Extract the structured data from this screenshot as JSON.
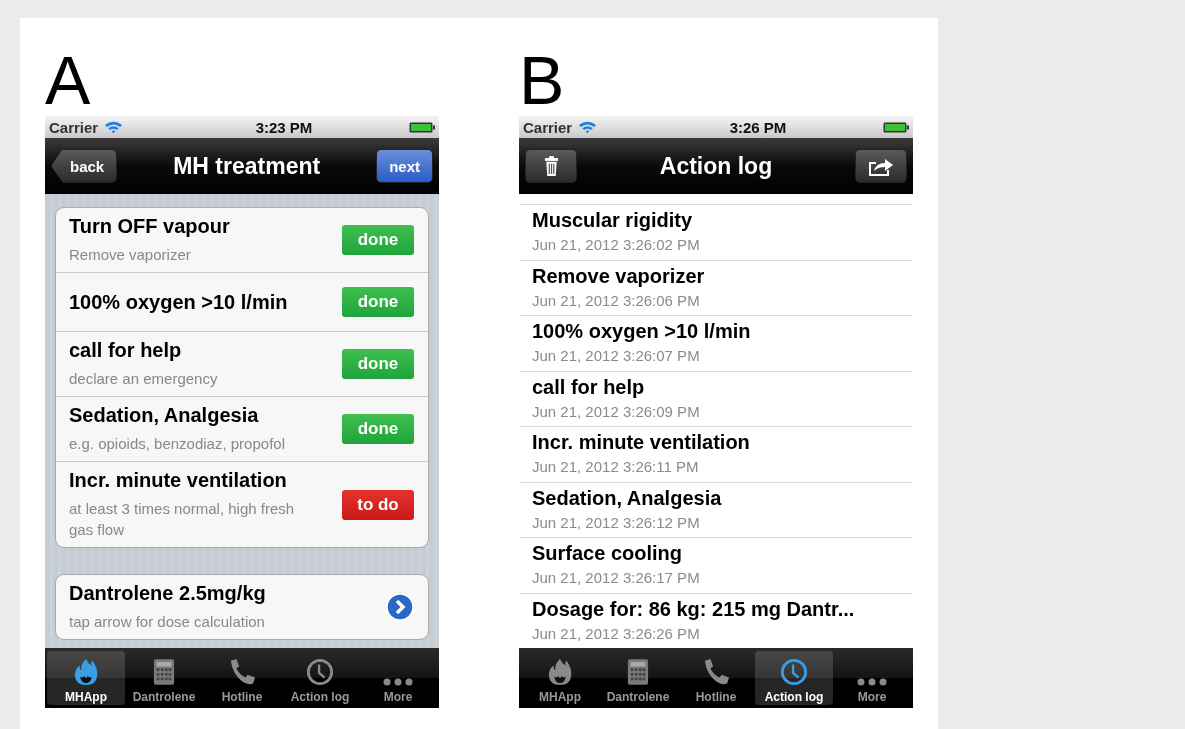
{
  "panels": [
    {
      "letter": "A",
      "status": {
        "carrier": "Carrier",
        "time": "3:23 PM"
      },
      "nav": {
        "title": "MH treatment",
        "left": {
          "kind": "back",
          "label": "back"
        },
        "right": {
          "kind": "next",
          "label": "next"
        }
      },
      "content": {
        "kind": "checklist",
        "groups": [
          {
            "rows": [
              {
                "title": "Turn OFF vapour",
                "subtitle": "Remove vaporizer",
                "status": {
                  "label": "done",
                  "done": true
                }
              },
              {
                "title": "100% oxygen >10 l/min",
                "status": {
                  "label": "done",
                  "done": true
                }
              },
              {
                "title": "call for help",
                "subtitle": "declare an emergency",
                "status": {
                  "label": "done",
                  "done": true
                }
              },
              {
                "title": "Sedation, Analgesia",
                "subtitle": "e.g. opioids, benzodiaz, propofol",
                "status": {
                  "label": "done",
                  "done": true
                }
              },
              {
                "title": "Incr. minute ventilation",
                "subtitle": "at least 3 times normal, high fresh gas flow",
                "status": {
                  "label": "to do",
                  "done": false
                }
              }
            ]
          },
          {
            "rows": [
              {
                "title": "Dantrolene 2.5mg/kg",
                "subtitle": "tap arrow for dose calculation",
                "disclosure": true
              }
            ]
          }
        ]
      },
      "tabs": [
        {
          "label": "MHApp",
          "selected": true
        },
        {
          "label": "Dantrolene",
          "selected": false
        },
        {
          "label": "Hotline",
          "selected": false
        },
        {
          "label": "Action log",
          "selected": false
        },
        {
          "label": "More",
          "selected": false
        }
      ]
    },
    {
      "letter": "B",
      "status": {
        "carrier": "Carrier",
        "time": "3:26 PM"
      },
      "nav": {
        "title": "Action log",
        "left": {
          "kind": "trash"
        },
        "right": {
          "kind": "share"
        }
      },
      "content": {
        "kind": "log",
        "entries": [
          {
            "title": "Muscular rigidity",
            "time": "Jun 21, 2012 3:26:02 PM"
          },
          {
            "title": "Remove vaporizer",
            "time": "Jun 21, 2012 3:26:06 PM"
          },
          {
            "title": "100% oxygen >10 l/min",
            "time": "Jun 21, 2012 3:26:07 PM"
          },
          {
            "title": "call for help",
            "time": "Jun 21, 2012 3:26:09 PM"
          },
          {
            "title": "Incr. minute ventilation",
            "time": "Jun 21, 2012 3:26:11 PM"
          },
          {
            "title": "Sedation, Analgesia",
            "time": "Jun 21, 2012 3:26:12 PM"
          },
          {
            "title": "Surface cooling",
            "time": "Jun 21, 2012 3:26:17 PM"
          },
          {
            "title": "Dosage for: 86 kg: 215 mg Dantr...",
            "time": "Jun 21, 2012 3:26:26 PM"
          }
        ]
      },
      "tabs": [
        {
          "label": "MHApp",
          "selected": false
        },
        {
          "label": "Dantrolene",
          "selected": false
        },
        {
          "label": "Hotline",
          "selected": false
        },
        {
          "label": "Action log",
          "selected": true
        },
        {
          "label": "More",
          "selected": false
        }
      ]
    }
  ]
}
